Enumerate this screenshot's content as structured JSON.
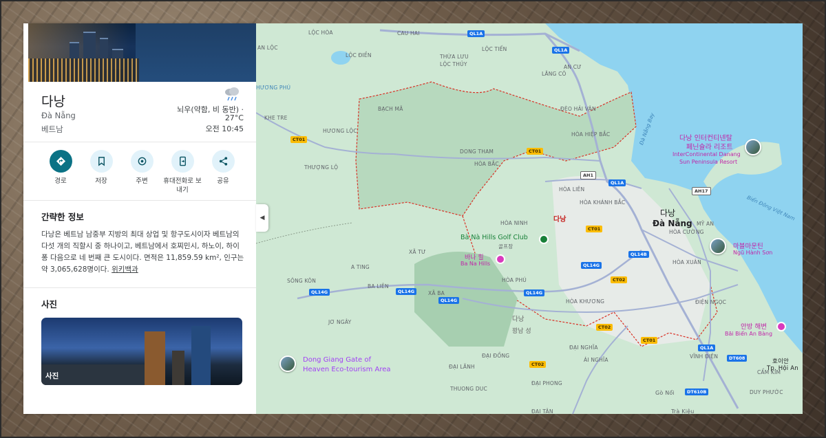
{
  "place": {
    "name": "다낭",
    "local_name": "Đà Nẵng",
    "country": "베트남"
  },
  "weather": {
    "icon": "rain-cloud-icon",
    "description": "뇌우(약함, 비 동반) ·",
    "temperature": "27°C",
    "time": "오전 10:45"
  },
  "actions": [
    {
      "label": "경로",
      "icon": "directions-icon"
    },
    {
      "label": "저장",
      "icon": "bookmark-icon"
    },
    {
      "label": "주변",
      "icon": "nearby-icon"
    },
    {
      "label": "휴대전화로 보내기",
      "icon": "send-to-phone-icon"
    },
    {
      "label": "공유",
      "icon": "share-icon"
    }
  ],
  "about": {
    "title": "간략한 정보",
    "text": "다낭은 베트남 남중부 지방의 최대 상업 및 항구도시이자 베트남의 다섯 개의 직할시 중 하나이고, 베트남에서 호찌민시, 하노이, 하이퐁 다음으로 네 번째 큰 도시이다. 면적은 11,859.59 km², 인구는 약 3,065,628명이다. ",
    "link": "위키백과"
  },
  "photos": {
    "title": "사진",
    "card_label": "사진"
  },
  "colors": {
    "primary_action": "#0b7285",
    "action_bg": "#e1f2fa",
    "sea": "#8fd3f0",
    "land": "#cfe8d4",
    "border": "#d93025"
  },
  "map": {
    "towns": [
      "LỘC HÒA",
      "CAU HAI",
      "AN LỘC",
      "LỘC ĐIỀN",
      "THỪA LƯU",
      "LỘC THỦY",
      "LỘC TIẾN",
      "AN CƯ",
      "LĂNG CÔ",
      "HƯƠNG PHÚ",
      "BẠCH MÃ",
      "KHE TRE",
      "HƯƠNG LỘC",
      "ĐÈO HẢI VÂN",
      "HÒA HIỆP BẮC",
      "DONG THAM",
      "HÒA BẮC",
      "THƯỢNG LỘ",
      "HÒA LIÊN",
      "HÒA KHÁNH BẮC",
      "HÒA NINH",
      "HÒA CƯỜNG",
      "MỸ AN",
      "HÒA XUÂN",
      "XÃ TƯ",
      "A TING",
      "SÔNG KÔN",
      "BA LIÊN",
      "XÃ BA",
      "HÒA PHÚ",
      "HÒA KHƯƠNG",
      "ĐIỆN NGỌC",
      "JƠ NGÂY",
      "ĐẠI ĐỒNG",
      "ĐẠI NGHĨA",
      "ÁI NGHĨA",
      "VĨNH ĐIỆN",
      "CẨM KIM",
      "ĐẠI LÃNH",
      "THUONG DUC",
      "ĐẠI PHONG",
      "Gò Nổi",
      "DUY PHƯỚC",
      "ĐẠI TÂN",
      "Trà Kiệu",
      "호이안",
      "Tp. Hội An"
    ],
    "city_ko": "다낭",
    "city_vi": "Đà Nẵng",
    "red_label": "다낭",
    "province_ko": "다낭",
    "province_ko2": "꽝남 성",
    "bay_label": "Đà Nẵng Bay",
    "sea_label": "Biển Đông Việt Nam",
    "pois": {
      "intercon_ko": "다낭 인터컨티넨탈",
      "intercon_ko2": "페닌슐라 리조트",
      "intercon_en": "InterContinental Danang",
      "intercon_en2": "Sun Peninsula Resort",
      "golf_en": "Bà Nà Hills Golf Club",
      "golf_ko": "골프장",
      "bana_ko": "바나 힐",
      "bana_vi": "Ba Na Hills",
      "marble_ko": "마블마운틴",
      "marble_vi": "Ngũ Hành Sơn",
      "anbang_ko": "안방 해변",
      "anbang_vi": "Bãi Biển An Bàng",
      "donggiang": "Dong Giang Gate of",
      "donggiang2": "Heaven Eco-tourism Area"
    },
    "shields": [
      "QL1A",
      "QL1A",
      "CT01",
      "CT01",
      "AH1",
      "QL1A",
      "AH17",
      "QL14B",
      "CT01",
      "QL14G",
      "CT02",
      "QL14G",
      "QL14G",
      "QL14G",
      "QL14G",
      "CT02",
      "CT01",
      "QL1A",
      "CT02",
      "DT608",
      "DT610B",
      "AH17"
    ]
  }
}
